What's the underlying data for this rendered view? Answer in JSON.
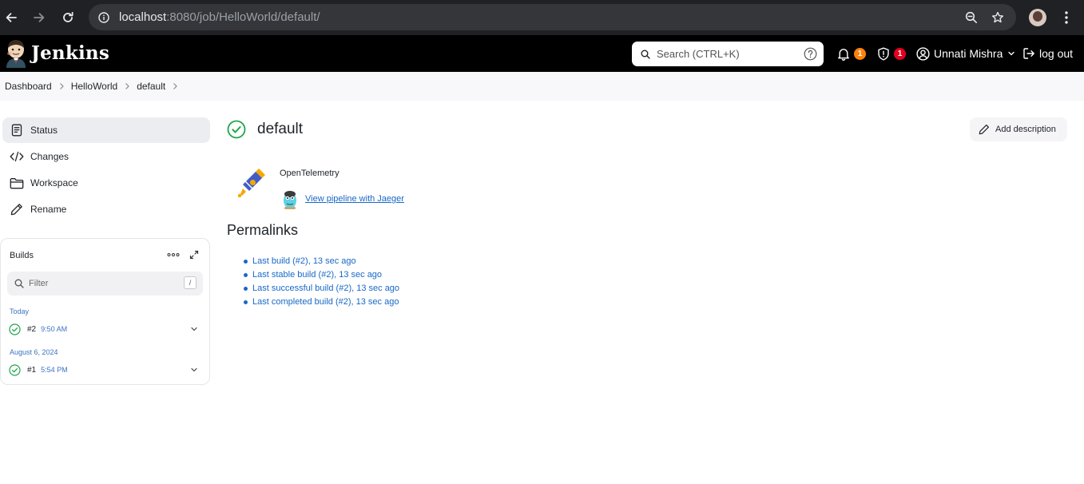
{
  "browser": {
    "url_host": "localhost",
    "url_path": ":8080/job/HelloWorld/default/"
  },
  "header": {
    "brand": "Jenkins",
    "search_placeholder": "Search (CTRL+K)",
    "notifications_count": "1",
    "security_count": "1",
    "user_name": "Unnati Mishra",
    "logout_label": "log out"
  },
  "breadcrumb": {
    "items": [
      "Dashboard",
      "HelloWorld",
      "default"
    ]
  },
  "sidebar": {
    "tasks": [
      {
        "label": "Status",
        "icon": "status-icon"
      },
      {
        "label": "Changes",
        "icon": "code-icon"
      },
      {
        "label": "Workspace",
        "icon": "folder-icon"
      },
      {
        "label": "Rename",
        "icon": "pencil-icon"
      }
    ]
  },
  "builds": {
    "title": "Builds",
    "filter_placeholder": "Filter",
    "filter_shortcut": "/",
    "groups": [
      {
        "label": "Today",
        "build": {
          "number": "#2",
          "time": "9:50 AM",
          "status": "success"
        }
      },
      {
        "label": "August 6, 2024",
        "build": {
          "number": "#1",
          "time": "5:54 PM",
          "status": "success"
        }
      }
    ]
  },
  "main": {
    "title": "default",
    "add_description_label": "Add description",
    "opentelemetry_label": "OpenTelemetry",
    "jaeger_link": "View pipeline with Jaeger",
    "permalinks_title": "Permalinks",
    "permalinks": [
      "Last build (#2), 13 sec ago",
      "Last stable build (#2), 13 sec ago",
      "Last successful build (#2), 13 sec ago",
      "Last completed build (#2), 13 sec ago"
    ]
  },
  "colors": {
    "success": "#1ea64b",
    "link": "#1868c7",
    "badge_orange": "#fe820a",
    "badge_red": "#e6001f"
  }
}
